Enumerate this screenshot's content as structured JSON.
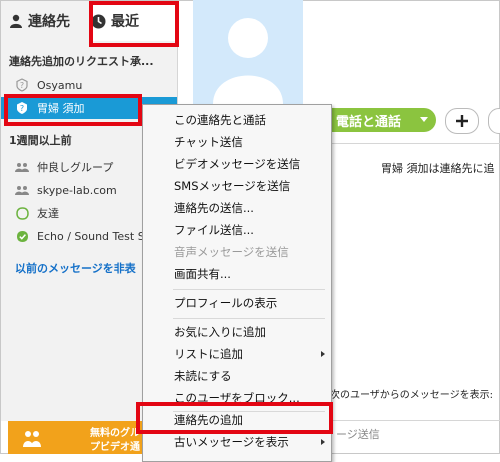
{
  "tabs": {
    "contacts_label": "連絡先",
    "recent_label": "最近"
  },
  "sidebar": {
    "section_requests": "連絡先追加のリクエスト承...",
    "request_items": [
      {
        "label": "Osyamu",
        "icon": "question-badge-icon"
      },
      {
        "label": "胃婦 須加",
        "icon": "question-badge-icon",
        "selected": true
      }
    ],
    "section_older": "1週間以上前",
    "older_items": [
      {
        "label": "仲良しグループ",
        "icon": "group-icon"
      },
      {
        "label": "skype-lab.com",
        "icon": "group-icon"
      },
      {
        "label": "友達",
        "icon": "offline-status-icon"
      },
      {
        "label": "Echo / Sound Test Se",
        "icon": "online-status-icon"
      }
    ],
    "hide_old_link": "以前のメッセージを非表",
    "banner": {
      "line1": "無料のグル",
      "line2": "プビデオ通"
    }
  },
  "main": {
    "call_button": "電話と通話",
    "notice": "胃婦 須加は連絡先に追",
    "allow_text": "次のユーザからのメッセージを表示:",
    "message_hint": "ージ送信"
  },
  "context_menu": {
    "items": [
      {
        "label": "この連絡先と通話"
      },
      {
        "label": "チャット送信"
      },
      {
        "label": "ビデオメッセージを送信"
      },
      {
        "label": "SMSメッセージを送信"
      },
      {
        "label": "連絡先の送信..."
      },
      {
        "label": "ファイル送信..."
      },
      {
        "label": "音声メッセージを送信",
        "disabled": true
      },
      {
        "label": "画面共有..."
      },
      {
        "label": "プロフィールの表示"
      },
      {
        "label": "お気に入りに追加"
      },
      {
        "label": "リストに追加",
        "submenu": true
      },
      {
        "label": "未読にする"
      },
      {
        "label": "このユーザをブロック..."
      },
      {
        "label": "連絡先の追加"
      },
      {
        "label": "古いメッセージを表示",
        "submenu": true
      }
    ]
  },
  "colors": {
    "selected_bg": "#1a9ad6",
    "highlight": "#e30613",
    "call_green": "#8bc43f",
    "banner_orange": "#f2a21b"
  }
}
